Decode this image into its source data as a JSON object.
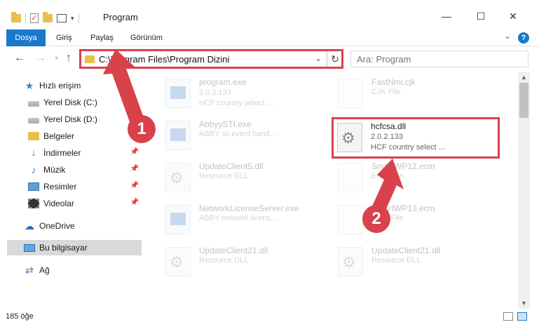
{
  "window": {
    "title": "Program",
    "minimize_glyph": "—",
    "maximize_glyph": "☐",
    "close_glyph": "✕"
  },
  "ribbon": {
    "tabs": [
      {
        "label": "Dosya"
      },
      {
        "label": "Giriş"
      },
      {
        "label": "Paylaş"
      },
      {
        "label": "Görünüm"
      }
    ],
    "help_label": "?"
  },
  "navbar": {
    "address": "C:\\Program Files\\Program Dizini",
    "search_placeholder": "Ara: Program"
  },
  "sidebar": {
    "items": [
      {
        "label": "Hızlı erişim",
        "icon": "star-icon"
      },
      {
        "label": "Yerel Disk (C:)",
        "icon": "drive-icon"
      },
      {
        "label": "Yerel Disk (D:)",
        "icon": "drive-icon"
      },
      {
        "label": "Belgeler",
        "icon": "folder-icon"
      },
      {
        "label": "İndirmeler",
        "icon": "download-icon"
      },
      {
        "label": "Müzik",
        "icon": "music-icon"
      },
      {
        "label": "Resimler",
        "icon": "pictures-icon"
      },
      {
        "label": "Videolar",
        "icon": "video-icon"
      },
      {
        "label": "OneDrive",
        "icon": "cloud-icon"
      },
      {
        "label": "Bu bilgisayar",
        "icon": "computer-icon"
      },
      {
        "label": "Ağ",
        "icon": "network-icon"
      }
    ]
  },
  "files": {
    "left": [
      {
        "name": "program.exe",
        "version": "2.0.2.133",
        "desc": "HCF country select ..."
      },
      {
        "name": "AbbyySTI.exe",
        "version": "",
        "desc": "ABBY sti event hand..."
      },
      {
        "name": "UpdateClient5.dll",
        "version": "",
        "desc": "Resource DLL"
      },
      {
        "name": "NetworkLicenseServer.exe",
        "version": "",
        "desc": "ABBY network licens..."
      },
      {
        "name": "UpdateClient21.dll",
        "version": "",
        "desc": "Resource DLL"
      }
    ],
    "right": [
      {
        "name": "FastNmi.cjk",
        "version": "",
        "desc": "CJK File"
      },
      {
        "name": "hcfcsa.dll",
        "version": "2.0.2.133",
        "desc": "HCF country select ..."
      },
      {
        "name": "SmartWP12.ecm",
        "version": "",
        "desc": "ECM File"
      },
      {
        "name": "SmartWP13.ecm",
        "version": "",
        "desc": "ECM File"
      },
      {
        "name": "UpdateClient21.dll",
        "version": "",
        "desc": "Resource DLL"
      }
    ]
  },
  "status": {
    "item_count": "185 öğe"
  },
  "callouts": {
    "step1": "1",
    "step2": "2"
  },
  "colors": {
    "accent": "#1979ca",
    "highlight": "#d9414b"
  }
}
